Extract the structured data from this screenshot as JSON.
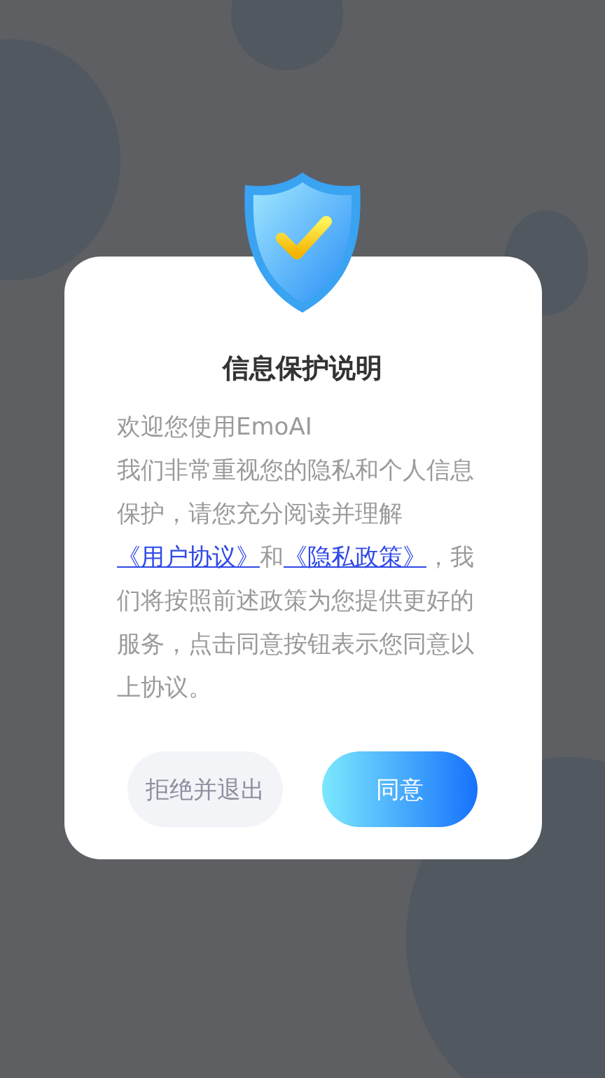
{
  "dialog": {
    "title": "信息保护说明",
    "welcome": "欢迎您使用EmoAI",
    "body": [
      {
        "kind": "text",
        "text": "我们非常重视您的隐私和个人信息保护，请您充分阅读并理解"
      },
      {
        "kind": "link",
        "text": "《用户协议》"
      },
      {
        "kind": "text",
        "text": "和"
      },
      {
        "kind": "link",
        "text": "《隐私政策》"
      },
      {
        "kind": "text",
        "text": "，我们将按照前述政策为您提供更好的服务，点击同意按钮表示您同意以上协议。"
      }
    ],
    "buttons": [
      {
        "kind": "secondary",
        "label": "拒绝并退出"
      },
      {
        "kind": "primary",
        "label": "同意"
      }
    ]
  }
}
